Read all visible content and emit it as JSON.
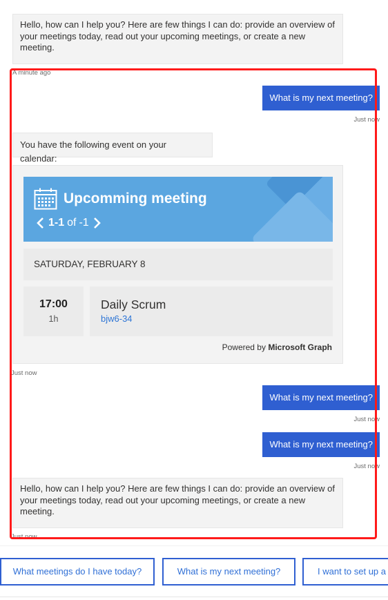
{
  "messages": {
    "bot_greeting_1": "Hello, how can I help you? Here are few things I can do: provide an overview of your meetings today, read out your upcoming meetings, or create a new meeting.",
    "ts_1": "A minute ago",
    "user_1": "What is my next meeting?",
    "ts_2": "Just now",
    "bot_calendar": "You have the following event on your calendar:",
    "ts_3": "Just now",
    "user_2": "What is my next meeting?",
    "ts_4": "Just now",
    "user_3": "What is my next meeting?",
    "ts_5": "Just now",
    "bot_greeting_2": "Hello, how can I help you? Here are few things I can do: provide an overview of your meetings today, read out your upcoming meetings, or create a new meeting.",
    "ts_6": "Just now"
  },
  "card": {
    "title": "Upcomming meeting",
    "pager_current": "1-1",
    "pager_of": "of",
    "pager_total": "-1",
    "date": "SATURDAY, FEBRUARY 8",
    "event": {
      "time": "17:00",
      "duration": "1h",
      "title": "Daily Scrum",
      "location": "bjw6-34"
    },
    "powered_prefix": "Powered by",
    "powered_brand": "Microsoft Graph"
  },
  "suggestions": [
    "What meetings do I have today?",
    "What is my next meeting?",
    "I want to set up a meeting"
  ],
  "colors": {
    "accent": "#2f5fd1",
    "banner": "#5ba6e0",
    "highlight": "#ff1a1a"
  },
  "icons": {
    "calendar": "calendar-icon",
    "prev": "chevron-left-icon",
    "next": "chevron-right-icon"
  }
}
